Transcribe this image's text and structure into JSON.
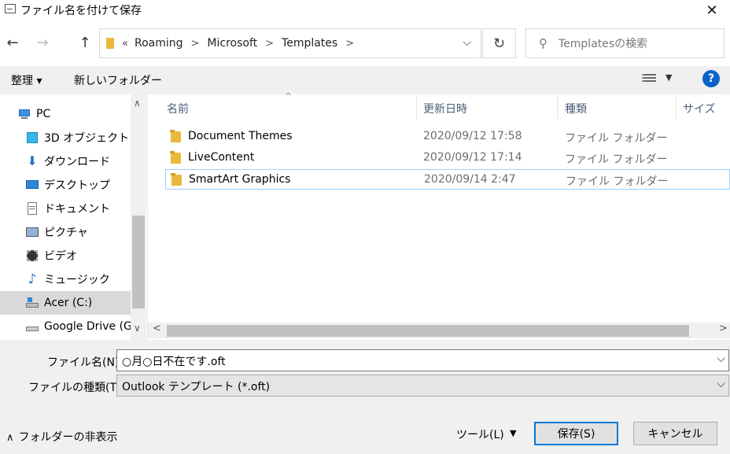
{
  "window": {
    "title": "ファイル名を付けて保存",
    "close": "✕"
  },
  "nav": {
    "back": "←",
    "forward": "→",
    "up": "↑",
    "overflow": "«",
    "breadcrumb": [
      "Roaming",
      "Microsoft",
      "Templates"
    ],
    "separator": ">",
    "dropdown": "⌵",
    "refresh": "↻",
    "search_icon": "⚲",
    "search_placeholder": "Templatesの検索"
  },
  "toolbar": {
    "organize": "整理 ▾",
    "new_folder": "新しいフォルダー",
    "help": "?",
    "view_dd": "▼"
  },
  "sidebar": {
    "items": [
      {
        "label": "PC",
        "icon": "pc-icon"
      },
      {
        "label": "3D オブジェクト",
        "icon": "cube-icon"
      },
      {
        "label": "ダウンロード",
        "icon": "download-icon"
      },
      {
        "label": "デスクトップ",
        "icon": "desktop-icon"
      },
      {
        "label": "ドキュメント",
        "icon": "document-icon"
      },
      {
        "label": "ピクチャ",
        "icon": "picture-icon"
      },
      {
        "label": "ビデオ",
        "icon": "video-icon"
      },
      {
        "label": "ミュージック",
        "icon": "music-icon"
      },
      {
        "label": "Acer (C:)",
        "icon": "drive-icon"
      },
      {
        "label": "Google Drive (G:",
        "icon": "drive-icon"
      }
    ],
    "scroll_up": "∧",
    "scroll_down": "∨"
  },
  "columns": {
    "name": "名前",
    "date": "更新日時",
    "type": "種類",
    "size": "サイズ",
    "sort_arrow": "^"
  },
  "files": [
    {
      "name": "Document Themes",
      "date": "2020/09/12 17:58",
      "type": "ファイル フォルダー"
    },
    {
      "name": "LiveContent",
      "date": "2020/09/12 17:14",
      "type": "ファイル フォルダー"
    },
    {
      "name": "SmartArt Graphics",
      "date": "2020/09/14 2:47",
      "type": "ファイル フォルダー"
    }
  ],
  "hscroll": {
    "left": "<",
    "right": ">"
  },
  "form": {
    "filename_label": "ファイル名(N):",
    "filename_value": "○月○日不在です.oft",
    "filetype_label": "ファイルの種類(T):",
    "filetype_value": "Outlook テンプレート (*.oft)",
    "dropdown": "⌵"
  },
  "footer": {
    "hide_folders": "フォルダーの非表示",
    "hide_caret": "∧",
    "tools": "ツール(L)",
    "tools_dd": "▼",
    "save": "保存(S)",
    "cancel": "キャンセル"
  }
}
